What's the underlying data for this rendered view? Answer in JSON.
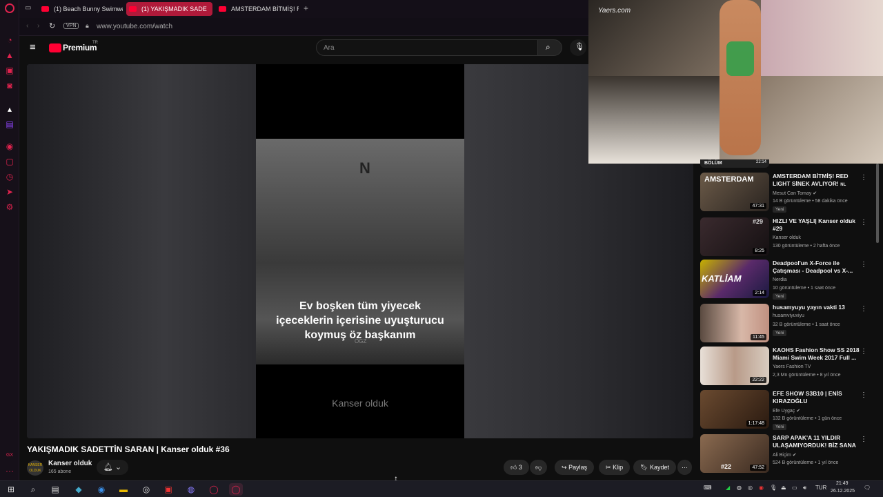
{
  "browser": {
    "tabs": [
      {
        "label": "(1) Beach Bunny Swimwe",
        "active": false
      },
      {
        "label": "(1) YAKIŞMADIK SADE",
        "active": true
      },
      {
        "label": "AMSTERDAM BİTMİŞ! RE",
        "active": false
      }
    ],
    "vpn_label": "VPN",
    "url": "www.youtube.com/watch"
  },
  "youtube": {
    "logo": "Premium",
    "logo_region": "TR",
    "search_placeholder": "Ara"
  },
  "player": {
    "caption_lines": [
      "Ev boşken tüm yiyecek",
      "içeceklerin içerisine uyuşturucu",
      "koymuş öz başkanım"
    ],
    "watermark": "Kanser olduk",
    "scene_mark": "N",
    "scene_label": "OGZ"
  },
  "popup": {
    "brand": "Yaers.com"
  },
  "video": {
    "title": "YAKIŞMADIK SADETTİN SARAN | Kanser olduk #36",
    "channel": "Kanser olduk",
    "subscribers": "165 abone",
    "avatar_text": "KANSER OLDUK",
    "likes": "3",
    "share_label": "Paylaş",
    "clip_label": "Klip",
    "save_label": "Kaydet"
  },
  "recommendations": [
    {
      "title": "AMSTERDAM BİTMİŞ! RED LIGHT SİNEK AVLIYOR!",
      "suffix": "NL",
      "channel": "Mesut Can Tomay",
      "verified": true,
      "meta": "14 B görüntüleme • 58 dakika önce",
      "duration": "47:31",
      "new": "Yeni",
      "thumb_text": "AMSTERDAM"
    },
    {
      "title": "HIZLI VE YAŞLI| Kanser olduk #29",
      "channel": "Kanser olduk",
      "verified": false,
      "meta": "130 görüntüleme • 2 hafta önce",
      "duration": "8:25",
      "new": "",
      "thumb_text": "#29"
    },
    {
      "title": "Deadpool'un X-Force ile Çatışması - Deadpool vs X-...",
      "channel": "Nerdia",
      "verified": false,
      "meta": "10 görüntüleme • 1 saat önce",
      "duration": "2:14",
      "new": "Yeni",
      "thumb_text": "KATLİAM"
    },
    {
      "title": "husamyuyu yayın vakti 13",
      "channel": "husamviyuviyu",
      "verified": false,
      "meta": "32 B görüntüleme • 1 saat önce",
      "duration": "11:45",
      "new": "Yeni",
      "thumb_text": ""
    },
    {
      "title": "KAOHS Fashion Show SS 2018 Miami Swim Week 2017 Full ...",
      "channel": "Yaers Fashion TV",
      "verified": false,
      "meta": "2,3 Mn görüntüleme • 8 yıl önce",
      "duration": "22:22",
      "new": "",
      "thumb_text": ""
    },
    {
      "title": "EFE SHOW S3B10 | ENİS KIRAZOĞLU",
      "channel": "Efe Uygaç",
      "verified": true,
      "meta": "132 B görüntüleme • 1 gün önce",
      "duration": "1:17:48",
      "new": "Yeni",
      "thumb_text": ""
    },
    {
      "title": "SARP APAK'A 11 YILDIR ULAŞAMIYORDUK! BİZ SANA ...",
      "channel": "Ali Biçim",
      "verified": true,
      "meta": "524 B görüntüleme • 1 yıl önce",
      "duration": "47:52",
      "new": "",
      "thumb_text": "#22"
    }
  ],
  "partial_item": {
    "label": "BÖLÜM",
    "duration": "22:14"
  },
  "taskbar": {
    "language": "TUR",
    "time": "21:49",
    "date": "26.12.2025"
  },
  "colors": {
    "accent": "#e0234e",
    "yt_red": "#ff0033",
    "bg": "#0f0f0f"
  }
}
